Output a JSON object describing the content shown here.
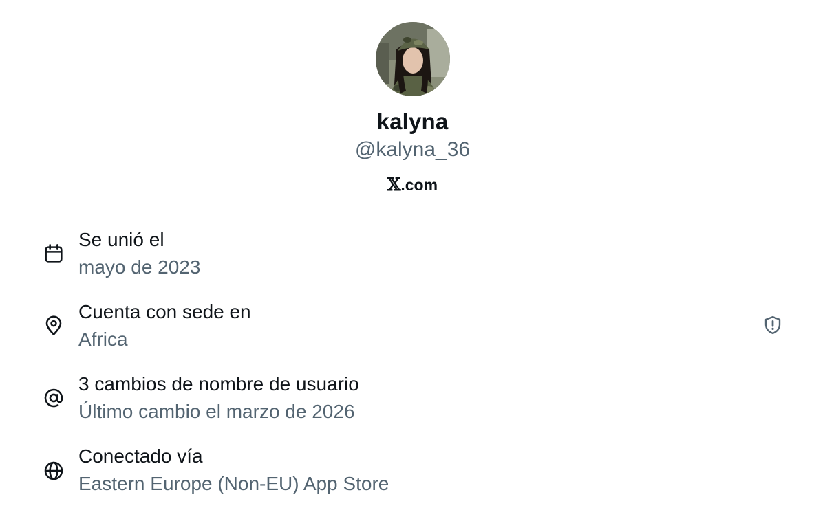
{
  "profile": {
    "display_name": "kalyna",
    "handle": "@kalyna_36",
    "platform_domain": ".com"
  },
  "details": [
    {
      "icon": "calendar-icon",
      "title": "Se unió el",
      "value": "mayo de 2023"
    },
    {
      "icon": "location-pin-icon",
      "title": "Cuenta con sede en",
      "value": "Africa"
    },
    {
      "icon": "at-sign-icon",
      "title": "3 cambios de nombre de usuario",
      "value": "Último cambio el marzo de 2026"
    },
    {
      "icon": "globe-icon",
      "title": "Conectado vía",
      "value": "Eastern Europe (Non-EU) App Store"
    }
  ],
  "colors": {
    "primary_text": "#0f1419",
    "secondary_text": "#536471"
  }
}
